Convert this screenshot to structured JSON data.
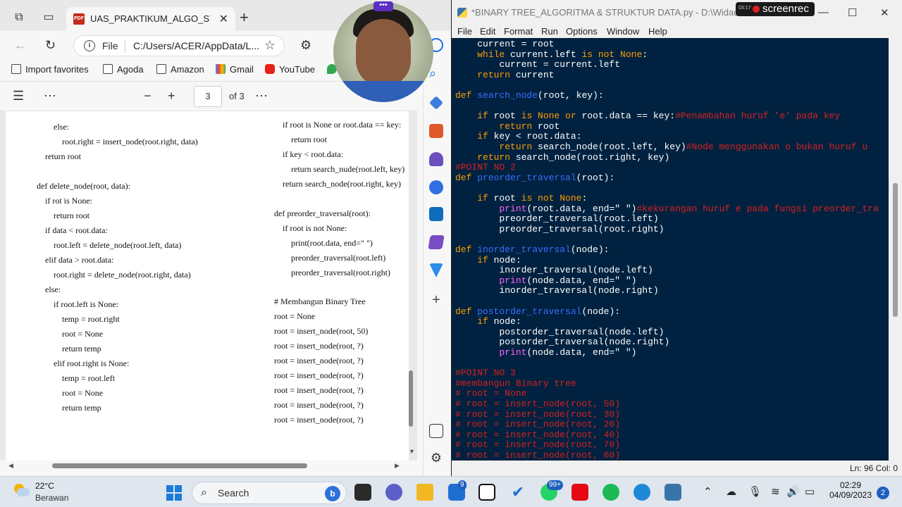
{
  "browser": {
    "tab_title": "UAS_PRAKTIKUM_ALGO_STRUKD",
    "address_prefix": "File",
    "address_path": "C:/Users/ACER/AppData/L...",
    "favorites": [
      "Import favorites",
      "Agoda",
      "Amazon",
      "Gmail",
      "YouTube"
    ],
    "pdf": {
      "current_page": "3",
      "total_pages": "of 3",
      "col1": [
        "else:",
        "root.right = insert_node(root.right, data)",
        "return root",
        "def delete_node(root, data):",
        "if rot is None:",
        "return root",
        "if data < root.data:",
        "root.left = delete_node(root.left, data)",
        "elif data > root.data:",
        "root.right = delete_node(root.right, data)",
        "else:",
        "if root.left is None:",
        "temp = root.right",
        "root = None",
        "return temp",
        "elif root.right is None:",
        "temp = root.left",
        "root = None",
        "return temp"
      ],
      "col2": [
        "if root is None or root.data == key:",
        "return root",
        "if key < root.data:",
        "return search_nude(root.left, key)",
        "return search_node(root.right, key)",
        "def preorder_traversal(root):",
        "if root is not None:",
        "print(root.data, end=\" \")",
        "preorder_traversal(root.left)",
        "preorder_traversal(root.right)",
        "# Membangun Binary Tree",
        "root = None",
        "root = insert_node(root, 50)",
        "root = insert_node(root, ?)",
        "root = insert_node(root, ?)",
        "root = insert_node(root, ?)",
        "root = insert_node(root, ?)",
        "root = insert_node(root, ?)",
        "root = insert_node(root, ?)"
      ]
    }
  },
  "editor": {
    "title": "*BINARY TREE_ALGORITMA & STRUKTUR DATA.py - D:\\Widad\\Alstruk\\",
    "menu": [
      "File",
      "Edit",
      "Format",
      "Run",
      "Options",
      "Window",
      "Help"
    ],
    "status": "Ln: 96   Col: 0",
    "recorder": {
      "time": "03:17",
      "label": "screenrec"
    },
    "code": [
      [
        [
          "    current = root",
          ""
        ]
      ],
      [
        [
          "    ",
          ""
        ],
        [
          "while",
          "kw"
        ],
        [
          " current.left ",
          ""
        ],
        [
          "is not None",
          "kw"
        ],
        [
          ":",
          ""
        ]
      ],
      [
        [
          "        current = current.left",
          ""
        ]
      ],
      [
        [
          "    ",
          ""
        ],
        [
          "return",
          "kw"
        ],
        [
          " current",
          ""
        ]
      ],
      [
        [
          "",
          ""
        ]
      ],
      [
        [
          "def",
          "kw"
        ],
        [
          " ",
          ""
        ],
        [
          "search_node",
          "fn"
        ],
        [
          "(root, key):",
          ""
        ]
      ],
      [
        [
          "",
          ""
        ]
      ],
      [
        [
          "    ",
          ""
        ],
        [
          "if",
          "kw"
        ],
        [
          " root ",
          ""
        ],
        [
          "is None or",
          "kw"
        ],
        [
          " root.data == key:",
          ""
        ],
        [
          "#Penambahan huruf 'e' pada key",
          "cm"
        ]
      ],
      [
        [
          "        ",
          ""
        ],
        [
          "return",
          "kw"
        ],
        [
          " root",
          ""
        ]
      ],
      [
        [
          "    ",
          ""
        ],
        [
          "if",
          "kw"
        ],
        [
          " key < root.data:",
          ""
        ]
      ],
      [
        [
          "        ",
          ""
        ],
        [
          "return",
          "kw"
        ],
        [
          " search_node(root.left, key)",
          ""
        ],
        [
          "#Node menggunakan o bukan huruf u",
          "cm"
        ]
      ],
      [
        [
          "    ",
          ""
        ],
        [
          "return",
          "kw"
        ],
        [
          " search_node(root.right, key)",
          ""
        ]
      ],
      [
        [
          "#POINT NO 2",
          "cm"
        ]
      ],
      [
        [
          "def",
          "kw"
        ],
        [
          " ",
          ""
        ],
        [
          "preorder_traversal",
          "fn"
        ],
        [
          "(root):",
          ""
        ]
      ],
      [
        [
          "",
          ""
        ]
      ],
      [
        [
          "    ",
          ""
        ],
        [
          "if",
          "kw"
        ],
        [
          " root ",
          ""
        ],
        [
          "is not None",
          "kw"
        ],
        [
          ":",
          ""
        ]
      ],
      [
        [
          "        ",
          ""
        ],
        [
          "print",
          "bi"
        ],
        [
          "(root.data, end=\" \")",
          ""
        ],
        [
          "#kekurangan huruf e pada fungsi preorder_tra",
          "cm"
        ]
      ],
      [
        [
          "        preorder_traversal(root.left)",
          ""
        ]
      ],
      [
        [
          "        preorder_traversal(root.right)",
          ""
        ]
      ],
      [
        [
          "",
          ""
        ]
      ],
      [
        [
          "def",
          "kw"
        ],
        [
          " ",
          ""
        ],
        [
          "inorder_traversal",
          "fn"
        ],
        [
          "(node):",
          ""
        ]
      ],
      [
        [
          "    ",
          ""
        ],
        [
          "if",
          "kw"
        ],
        [
          " node:",
          ""
        ]
      ],
      [
        [
          "        inorder_traversal(node.left)",
          ""
        ]
      ],
      [
        [
          "        ",
          ""
        ],
        [
          "print",
          "bi"
        ],
        [
          "(node.data, end=\" \")",
          ""
        ]
      ],
      [
        [
          "        inorder_traversal(node.right)",
          ""
        ]
      ],
      [
        [
          "",
          ""
        ]
      ],
      [
        [
          "def",
          "kw"
        ],
        [
          " ",
          ""
        ],
        [
          "postorder_traversal",
          "fn"
        ],
        [
          "(node):",
          ""
        ]
      ],
      [
        [
          "    ",
          ""
        ],
        [
          "if",
          "kw"
        ],
        [
          " node:",
          ""
        ]
      ],
      [
        [
          "        postorder_traversal(node.left)",
          ""
        ]
      ],
      [
        [
          "        postorder_traversal(node.right)",
          ""
        ]
      ],
      [
        [
          "        ",
          ""
        ],
        [
          "print",
          "bi"
        ],
        [
          "(node.data, end=\" \")",
          ""
        ]
      ],
      [
        [
          "",
          ""
        ]
      ],
      [
        [
          "#POINT NO 3",
          "cm"
        ]
      ],
      [
        [
          "#membangun Binary tree",
          "cm"
        ]
      ],
      [
        [
          "# root = None",
          "cm"
        ]
      ],
      [
        [
          "# root = insert_node(root, 50)",
          "cm"
        ]
      ],
      [
        [
          "# root = insert_node(root, 30)",
          "cm"
        ]
      ],
      [
        [
          "# root = insert_node(root, 20)",
          "cm"
        ]
      ],
      [
        [
          "# root = insert_node(root, 40)",
          "cm"
        ]
      ],
      [
        [
          "# root = insert_node(root, 70)",
          "cm"
        ]
      ],
      [
        [
          "# root = insert_node(root, 60)",
          "cm"
        ]
      ]
    ]
  },
  "taskbar": {
    "temperature": "22°C",
    "condition": "Berawan",
    "search_label": "Search",
    "time": "02:29",
    "date": "04/09/2023",
    "notifications": "2",
    "badge_9": "9",
    "badge_99": "99+"
  },
  "colors": {
    "editor_bg": "#002240",
    "keyword": "#ff9d00",
    "function": "#3b6dff",
    "builtin": "#ff62ff",
    "comment": "#d81f1f"
  }
}
